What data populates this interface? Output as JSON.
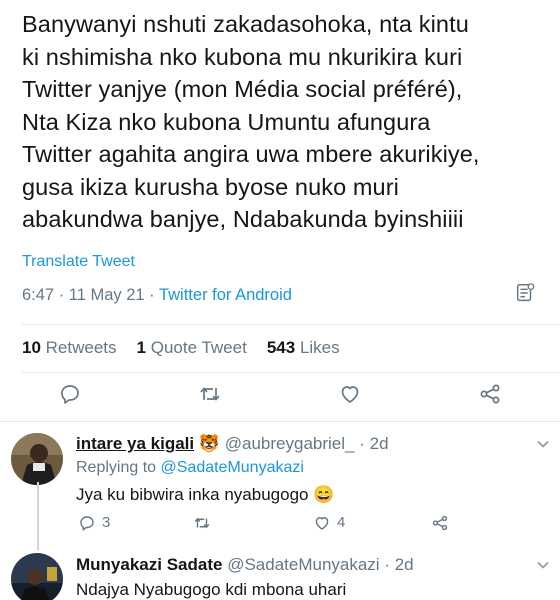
{
  "tweet": {
    "text_lines": [
      "Banywanyi nshuti zakadasohoka, nta kintu",
      "ki nshimisha nko kubona mu nkurikira kuri",
      "Twitter yanjye (mon Média social préféré),",
      "Nta Kiza nko kubona Umuntu afungura",
      "Twitter agahita angira uwa mbere akurikiye,",
      "gusa ikiza kurusha byose nuko muri",
      "abakundwa banjye, Ndabakunda byinshiiii"
    ],
    "translate_label": "Translate Tweet",
    "time": "6:47 · 11 May 21 · ",
    "source": "Twitter for Android",
    "retweets_count": "10",
    "retweets_label": "Retweets",
    "quotes_count": "1",
    "quotes_label": "Quote Tweet",
    "likes_count": "543",
    "likes_label": "Likes"
  },
  "replies": [
    {
      "name": "intare ya kigali",
      "emoji": "🐯",
      "handle": "@aubreygabriel_",
      "age": "· 2d",
      "replying_prefix": "Replying to ",
      "replying_to": "@SadateMunyakazi",
      "text": "Jya ku bibwira inka nyabugogo 😄",
      "reply_count": "3",
      "like_count": "4"
    },
    {
      "name": "Munyakazi Sadate",
      "handle": "@SadateMunyakazi",
      "age": "· 2d",
      "text": "Ndajya Nyabugogo kdi mbona uhari"
    }
  ],
  "colors": {
    "text": "#14171a",
    "secondary": "#657786",
    "link": "#1b95e0",
    "divider": "#e1e8ed"
  },
  "icons": [
    "reply-icon",
    "retweet-icon",
    "like-icon",
    "share-icon",
    "analytics-icon",
    "chevron-down-icon"
  ]
}
